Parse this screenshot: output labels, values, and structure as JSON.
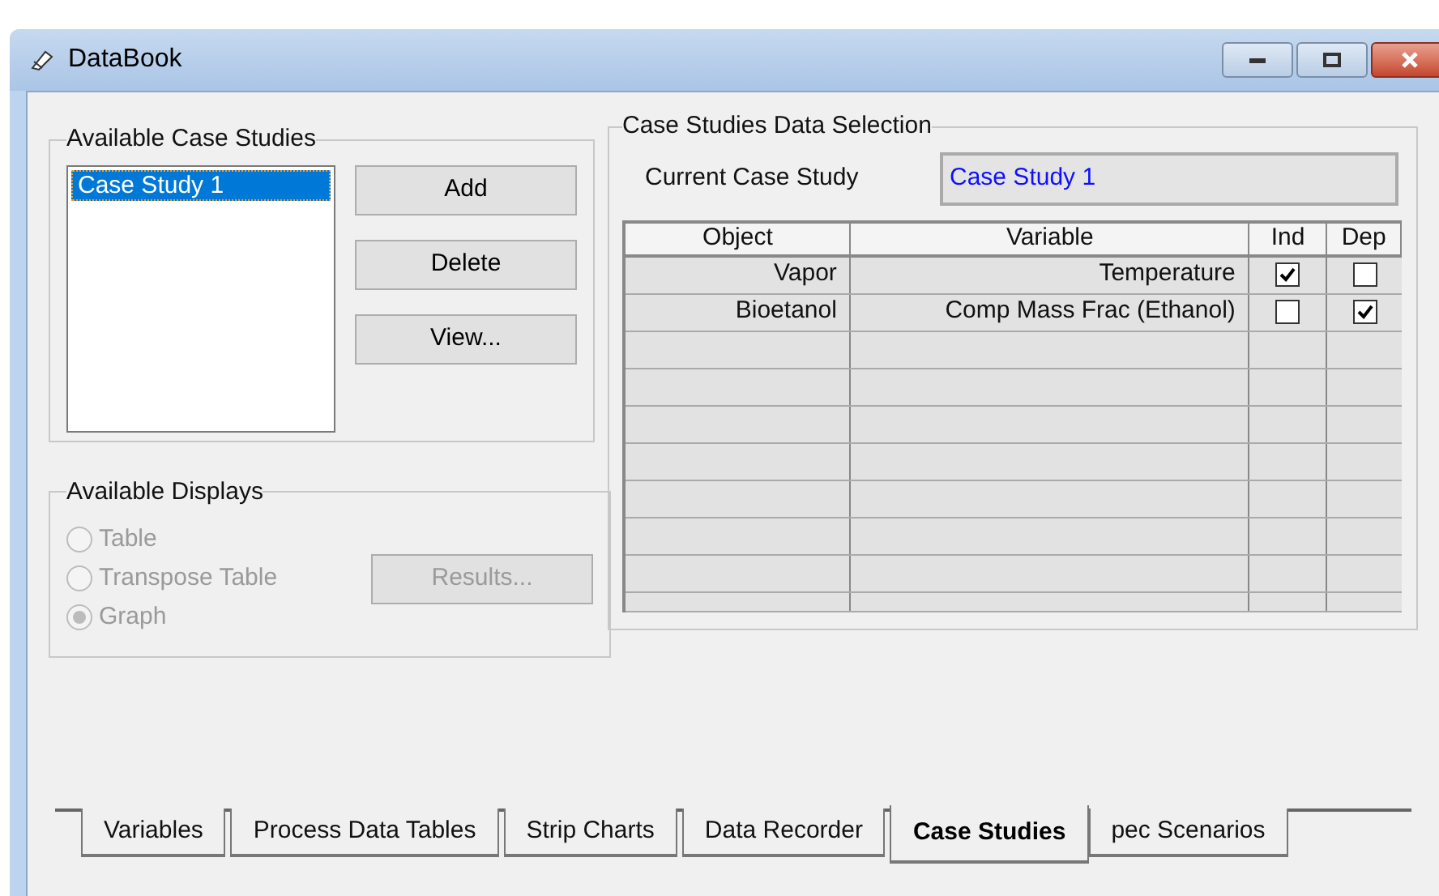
{
  "window": {
    "title": "DataBook"
  },
  "case_studies": {
    "legend": "Available Case Studies",
    "items": [
      {
        "label": "Case Study 1",
        "selected": true
      }
    ],
    "buttons": [
      {
        "label": "Add",
        "disabled": false
      },
      {
        "label": "Delete",
        "disabled": false
      },
      {
        "label": "View...",
        "disabled": false
      }
    ]
  },
  "displays": {
    "legend": "Available Displays",
    "options": [
      {
        "label": "Table",
        "selected": false,
        "disabled": true
      },
      {
        "label": "Transpose Table",
        "selected": false,
        "disabled": true
      },
      {
        "label": "Graph",
        "selected": true,
        "disabled": true
      }
    ],
    "button": {
      "label": "Results...",
      "disabled": true
    }
  },
  "data_selection": {
    "legend": "Case Studies Data Selection",
    "current_label": "Current Case Study",
    "current_value": "Case Study 1",
    "columns": [
      "Object",
      "Variable",
      "Ind",
      "Dep"
    ],
    "rows": [
      {
        "object": "Vapor",
        "variable": "Temperature",
        "ind": true,
        "dep": false
      },
      {
        "object": "Bioetanol",
        "variable": "Comp Mass Frac (Ethanol)",
        "ind": false,
        "dep": true
      }
    ]
  },
  "tabs": [
    {
      "label": "Variables",
      "selected": false
    },
    {
      "label": "Process Data Tables",
      "selected": false
    },
    {
      "label": "Strip Charts",
      "selected": false
    },
    {
      "label": "Data Recorder",
      "selected": false
    },
    {
      "label": "Case Studies",
      "selected": true
    },
    {
      "label": "pec Scenarios",
      "selected": false
    }
  ]
}
